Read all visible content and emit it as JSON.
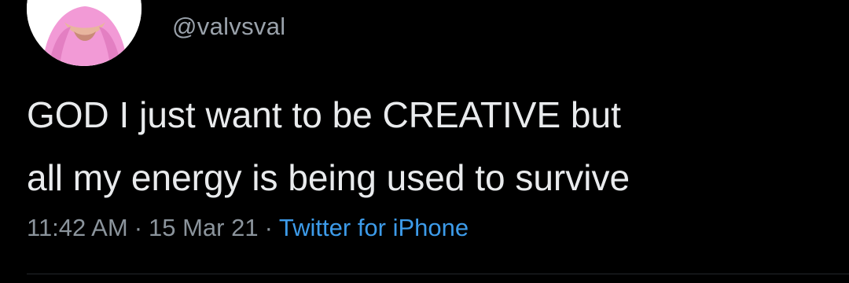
{
  "tweet": {
    "handle": "@valvsval",
    "text_lines": [
      "GOD I just want to be CREATIVE but",
      "all my energy is being used to survive"
    ],
    "time": "11:42 AM",
    "date": "15 Mar 21",
    "separator": "·",
    "source": "Twitter for iPhone"
  },
  "colors": {
    "background": "#000000",
    "text": "#e9ebed",
    "secondary_text": "#8b949c",
    "link": "#3d9be9",
    "avatar_accent": "#f29ad6"
  },
  "icons": {
    "avatar": "profile-photo"
  }
}
